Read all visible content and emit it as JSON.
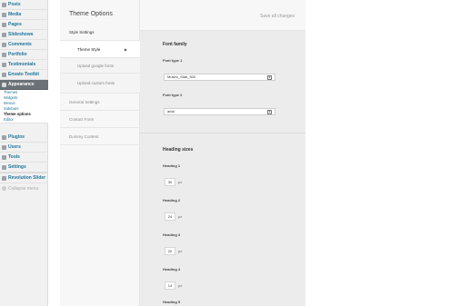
{
  "sidebar": {
    "items": [
      {
        "label": "Posts"
      },
      {
        "label": "Media"
      },
      {
        "label": "Pages"
      },
      {
        "label": "Slideshows"
      },
      {
        "label": "Comments"
      },
      {
        "label": "Portfolio"
      },
      {
        "label": "Testimonials"
      },
      {
        "label": "Envato Toolkit"
      },
      {
        "label": "Appearance"
      }
    ],
    "appearance_sub": [
      "Themes",
      "Widgets",
      "Menus",
      "Sidebars",
      "Theme options",
      "Editor"
    ],
    "items2": [
      {
        "label": "Plugins"
      },
      {
        "label": "Users"
      },
      {
        "label": "Tools"
      },
      {
        "label": "Settings"
      },
      {
        "label": "Revolution Slider"
      },
      {
        "label": "Collapse menu"
      }
    ]
  },
  "options": {
    "title": "Theme Options",
    "save_all": "Save all changes",
    "nav": {
      "style_settings": "Style Settings",
      "theme_style": "Theme Style",
      "upload_google_fonts": "Upload google fonts",
      "upload_custom_fonts": "Upload custom fonts",
      "general_settings": "General Settings",
      "contact_form": "Contact Form",
      "dummy_content": "Dummy Content"
    },
    "font_family": {
      "title": "Font family",
      "type1_label": "Font type 1",
      "type1_value": "Museo_Slab_500",
      "type2_label": "Font type 2",
      "type2_value": "arial"
    },
    "heading_sizes": {
      "title": "Heading sizes",
      "unit": "px",
      "items": [
        {
          "label": "Heading 1",
          "value": "30"
        },
        {
          "label": "Heading 2",
          "value": "24"
        },
        {
          "label": "Heading 3",
          "value": "20"
        },
        {
          "label": "Heading 4",
          "value": "14"
        },
        {
          "label": "Heading 5",
          "value": ""
        }
      ]
    }
  }
}
